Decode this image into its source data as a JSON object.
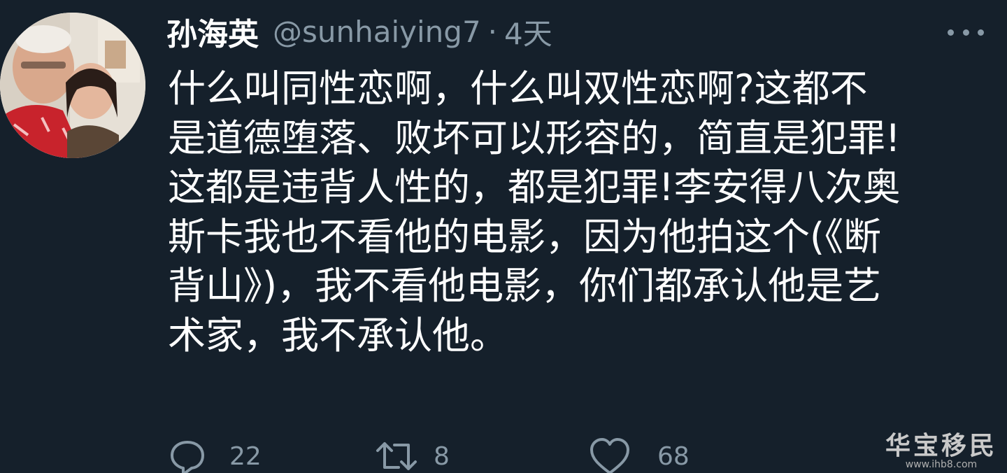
{
  "tweet": {
    "display_name": "孙海英",
    "handle": "@sunhaiying7",
    "separator": "·",
    "time": "4天",
    "lines": [
      "什么叫同性恋啊，什么叫双性恋啊?这都不",
      "是道德堕落、败坏可以形容的，简直是犯罪!",
      "这都是违背人性的，都是犯罪!李安得八次奥",
      "斯卡我也不看他的电影，因为他拍这个(《断",
      "背山》)，我不看他电影，你们都承认他是艺",
      "术家，我不承认他。"
    ],
    "actions": {
      "reply_count": "22",
      "retweet_count": "8",
      "like_count": "68"
    }
  },
  "icons": {
    "more": "more-horizontal-icon",
    "reply": "reply-icon",
    "retweet": "retweet-icon",
    "like": "heart-icon"
  },
  "colors": {
    "background": "#15202b",
    "text": "#ffffff",
    "secondary": "#8899a6"
  },
  "watermark": {
    "title": "华宝移民",
    "url": "www.ihb8.com"
  }
}
